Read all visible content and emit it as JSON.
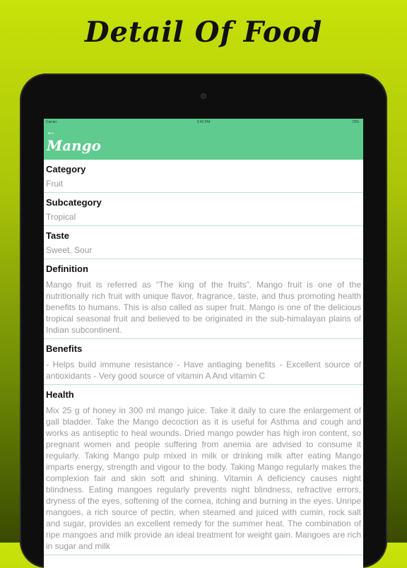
{
  "promo": {
    "title": "Detail Of Food"
  },
  "status_bar": {
    "carrier": "Carrier",
    "time": "3:42 PM",
    "battery": "72%"
  },
  "app_bar": {
    "back_icon": "←",
    "title": "Mango"
  },
  "sections": [
    {
      "title": "Category",
      "value": "Fruit"
    },
    {
      "title": "Subcategory",
      "value": "Tropical"
    },
    {
      "title": "Taste",
      "value": "Sweet, Sour"
    },
    {
      "title": "Definition",
      "value": "Mango fruit is referred as “The king of the fruits”. Mango fruit is one of the nutritionally rich fruit with unique flavor, fragrance, taste, and thus promoting health benefits to humans. This is also called as super fruit. Mango is one of the delicious tropical seasonal fruit and believed to be originated in the sub-himalayan plains of Indian subcontinent."
    },
    {
      "title": "Benefits",
      "value": "- Helps build immune resistance - Have antiaging benefits - Excellent source of antioxidants - Very good source of vitamin A And vitamin C"
    },
    {
      "title": "Health",
      "value": "Mix 25 g of honey in 300 ml mango juice. Take it daily to cure the enlargement of gall bladder. Take the Mango decoction as it is useful for Asthma and cough and works as antiseptic to heal wounds. Dried mango powder has high iron content, so pregnant women and people suffering from anemia are advised to consume it regularly. Taking Mango pulp mixed in milk or drinking milk after eating Mango imparts energy, strength and vigour to the body. Taking Mango regularly makes the complexion fair and skin soft and shining. Vitamin A deficiency causes night blindness. Eating mangoes regularly prevents night blindness, refractive errors, dryness of the eyes, softening of the cornea, itching and burning in the eyes. Unripe mangoes, a rich source of pectin, when steamed and juiced with cumin, rock salt and sugar, provides an excellent remedy for the summer heat. The combination of ripe mangoes and milk provide an ideal treatment for weight gain. Mangoes are rich in sugar and milk"
    }
  ]
}
